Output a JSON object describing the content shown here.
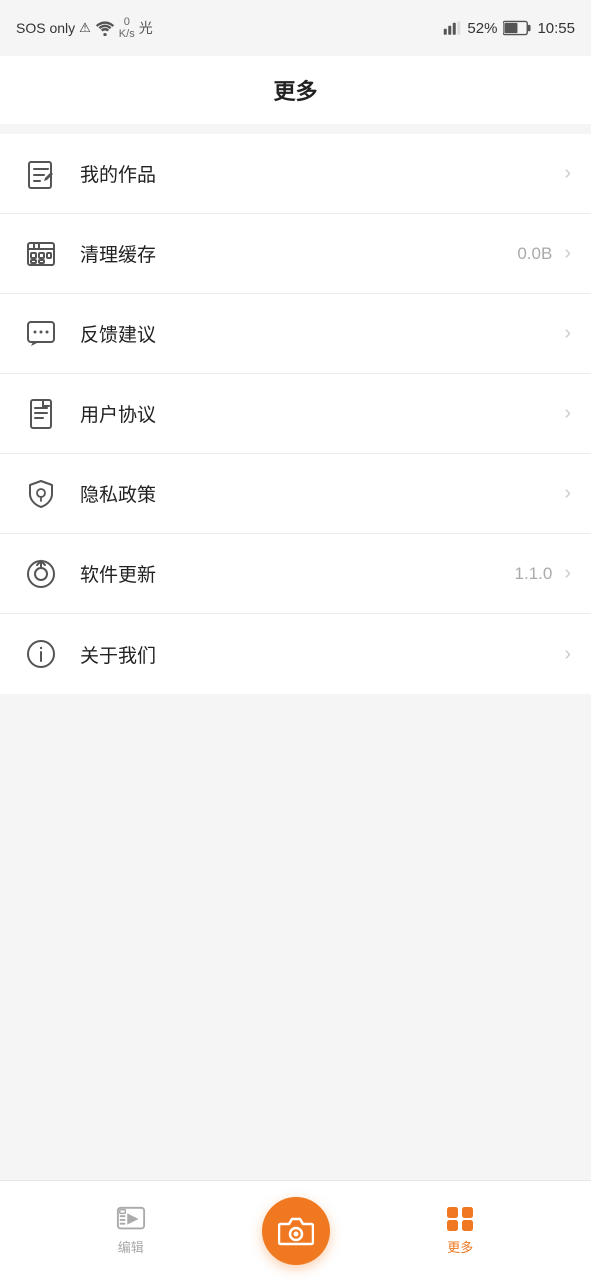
{
  "statusBar": {
    "sos": "SOS only",
    "network": "0\nK/s",
    "battery": "52%",
    "time": "10:55"
  },
  "header": {
    "title": "更多"
  },
  "menuItems": [
    {
      "id": "my-works",
      "label": "我的作品",
      "value": "",
      "iconType": "edit"
    },
    {
      "id": "clear-cache",
      "label": "清理缓存",
      "value": "0.0B",
      "iconType": "cache"
    },
    {
      "id": "feedback",
      "label": "反馈建议",
      "value": "",
      "iconType": "feedback"
    },
    {
      "id": "user-agreement",
      "label": "用户协议",
      "value": "",
      "iconType": "doc"
    },
    {
      "id": "privacy-policy",
      "label": "隐私政策",
      "value": "",
      "iconType": "shield"
    },
    {
      "id": "software-update",
      "label": "软件更新",
      "value": "1.1.0",
      "iconType": "update"
    },
    {
      "id": "about-us",
      "label": "关于我们",
      "value": "",
      "iconType": "info"
    }
  ],
  "bottomNav": {
    "edit": "编辑",
    "camera": "",
    "more": "更多"
  }
}
